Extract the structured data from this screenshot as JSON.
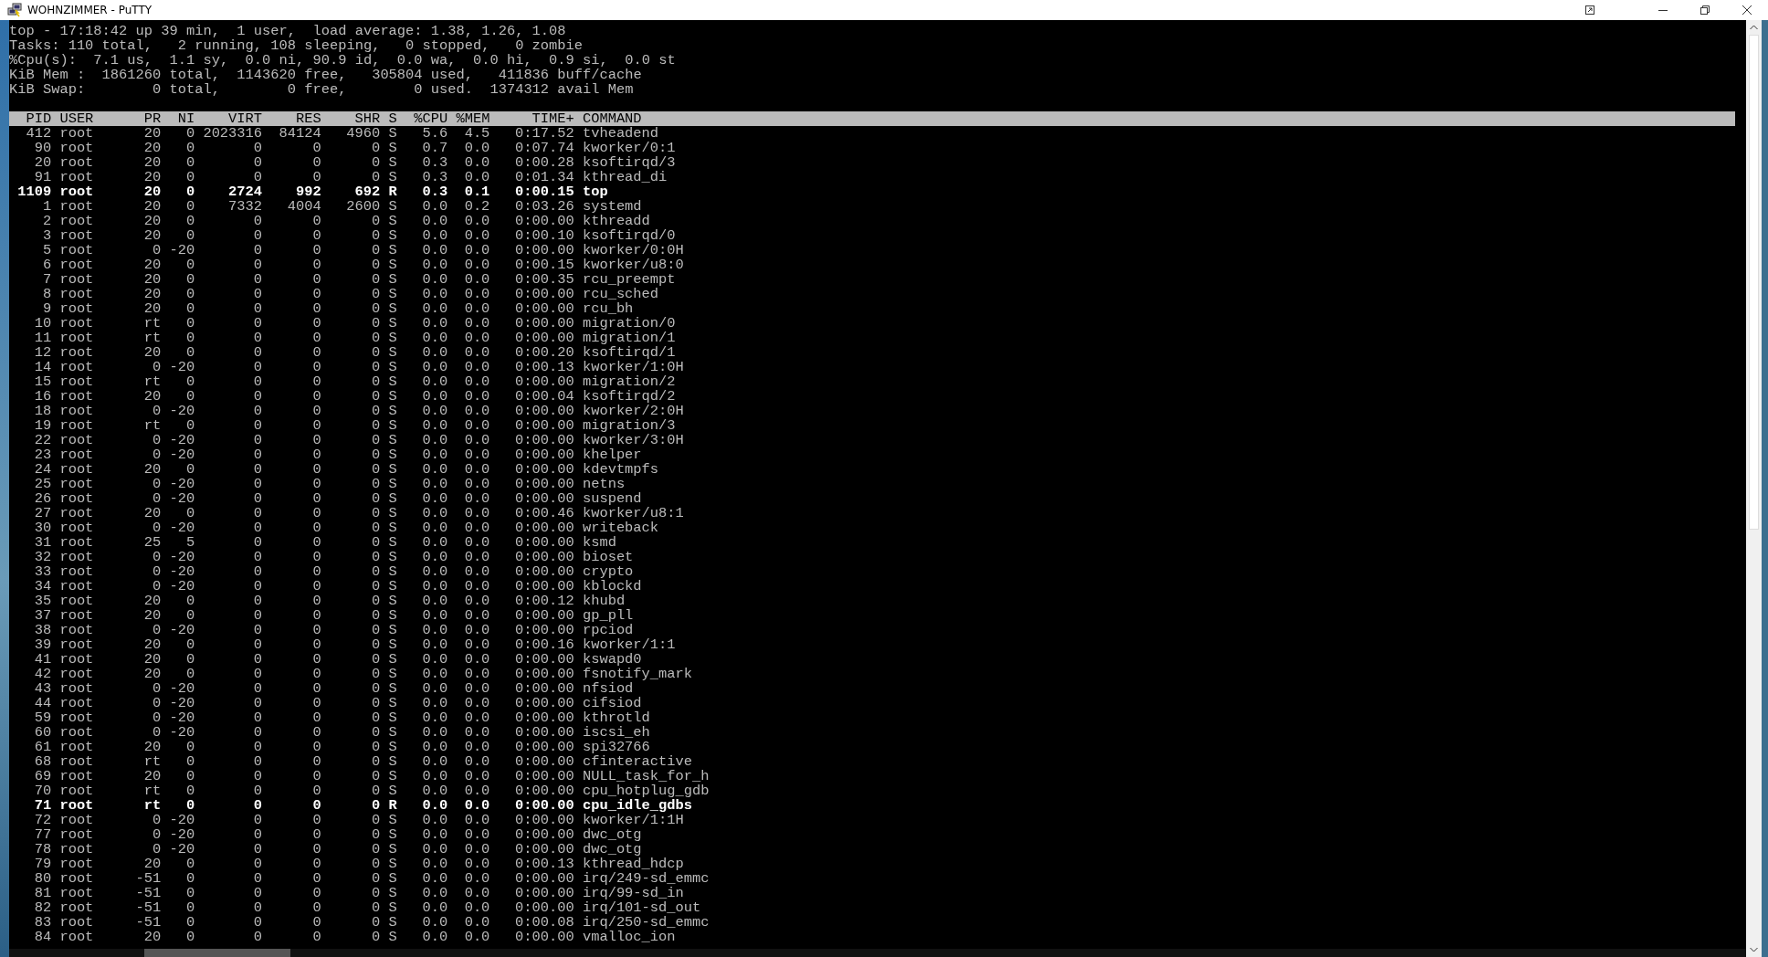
{
  "window": {
    "title": "WOHNZIMMER - PuTTY"
  },
  "summary": [
    "top - 17:18:42 up 39 min,  1 user,  load average: 1.38, 1.26, 1.08",
    "Tasks: 110 total,   2 running, 108 sleeping,   0 stopped,   0 zombie",
    "%Cpu(s):  7.1 us,  1.1 sy,  0.0 ni, 90.9 id,  0.0 wa,  0.0 hi,  0.9 si,  0.0 st",
    "KiB Mem :  1861260 total,  1143620 free,   305804 used,   411836 buff/cache",
    "KiB Swap:        0 total,        0 free,        0 used.  1374312 avail Mem"
  ],
  "columns": [
    "PID",
    "USER",
    "PR",
    "NI",
    "VIRT",
    "RES",
    "SHR",
    "S",
    "%CPU",
    "%MEM",
    "TIME+",
    "COMMAND"
  ],
  "rows": [
    {
      "cells": [
        "412",
        "root",
        "20",
        "0",
        "2023316",
        "84124",
        "4960",
        "S",
        "5.6",
        "4.5",
        "0:17.52",
        "tvheadend"
      ],
      "highlighted": false
    },
    {
      "cells": [
        "90",
        "root",
        "20",
        "0",
        "0",
        "0",
        "0",
        "S",
        "0.7",
        "0.0",
        "0:07.74",
        "kworker/0:1"
      ],
      "highlighted": false
    },
    {
      "cells": [
        "20",
        "root",
        "20",
        "0",
        "0",
        "0",
        "0",
        "S",
        "0.3",
        "0.0",
        "0:00.28",
        "ksoftirqd/3"
      ],
      "highlighted": false
    },
    {
      "cells": [
        "91",
        "root",
        "20",
        "0",
        "0",
        "0",
        "0",
        "S",
        "0.3",
        "0.0",
        "0:01.34",
        "kthread_di"
      ],
      "highlighted": false
    },
    {
      "cells": [
        "1109",
        "root",
        "20",
        "0",
        "2724",
        "992",
        "692",
        "R",
        "0.3",
        "0.1",
        "0:00.15",
        "top"
      ],
      "highlighted": true
    },
    {
      "cells": [
        "1",
        "root",
        "20",
        "0",
        "7332",
        "4004",
        "2600",
        "S",
        "0.0",
        "0.2",
        "0:03.26",
        "systemd"
      ],
      "highlighted": false
    },
    {
      "cells": [
        "2",
        "root",
        "20",
        "0",
        "0",
        "0",
        "0",
        "S",
        "0.0",
        "0.0",
        "0:00.00",
        "kthreadd"
      ],
      "highlighted": false
    },
    {
      "cells": [
        "3",
        "root",
        "20",
        "0",
        "0",
        "0",
        "0",
        "S",
        "0.0",
        "0.0",
        "0:00.10",
        "ksoftirqd/0"
      ],
      "highlighted": false
    },
    {
      "cells": [
        "5",
        "root",
        "0",
        "-20",
        "0",
        "0",
        "0",
        "S",
        "0.0",
        "0.0",
        "0:00.00",
        "kworker/0:0H"
      ],
      "highlighted": false
    },
    {
      "cells": [
        "6",
        "root",
        "20",
        "0",
        "0",
        "0",
        "0",
        "S",
        "0.0",
        "0.0",
        "0:00.15",
        "kworker/u8:0"
      ],
      "highlighted": false
    },
    {
      "cells": [
        "7",
        "root",
        "20",
        "0",
        "0",
        "0",
        "0",
        "S",
        "0.0",
        "0.0",
        "0:00.35",
        "rcu_preempt"
      ],
      "highlighted": false
    },
    {
      "cells": [
        "8",
        "root",
        "20",
        "0",
        "0",
        "0",
        "0",
        "S",
        "0.0",
        "0.0",
        "0:00.00",
        "rcu_sched"
      ],
      "highlighted": false
    },
    {
      "cells": [
        "9",
        "root",
        "20",
        "0",
        "0",
        "0",
        "0",
        "S",
        "0.0",
        "0.0",
        "0:00.00",
        "rcu_bh"
      ],
      "highlighted": false
    },
    {
      "cells": [
        "10",
        "root",
        "rt",
        "0",
        "0",
        "0",
        "0",
        "S",
        "0.0",
        "0.0",
        "0:00.00",
        "migration/0"
      ],
      "highlighted": false
    },
    {
      "cells": [
        "11",
        "root",
        "rt",
        "0",
        "0",
        "0",
        "0",
        "S",
        "0.0",
        "0.0",
        "0:00.00",
        "migration/1"
      ],
      "highlighted": false
    },
    {
      "cells": [
        "12",
        "root",
        "20",
        "0",
        "0",
        "0",
        "0",
        "S",
        "0.0",
        "0.0",
        "0:00.20",
        "ksoftirqd/1"
      ],
      "highlighted": false
    },
    {
      "cells": [
        "14",
        "root",
        "0",
        "-20",
        "0",
        "0",
        "0",
        "S",
        "0.0",
        "0.0",
        "0:00.13",
        "kworker/1:0H"
      ],
      "highlighted": false
    },
    {
      "cells": [
        "15",
        "root",
        "rt",
        "0",
        "0",
        "0",
        "0",
        "S",
        "0.0",
        "0.0",
        "0:00.00",
        "migration/2"
      ],
      "highlighted": false
    },
    {
      "cells": [
        "16",
        "root",
        "20",
        "0",
        "0",
        "0",
        "0",
        "S",
        "0.0",
        "0.0",
        "0:00.04",
        "ksoftirqd/2"
      ],
      "highlighted": false
    },
    {
      "cells": [
        "18",
        "root",
        "0",
        "-20",
        "0",
        "0",
        "0",
        "S",
        "0.0",
        "0.0",
        "0:00.00",
        "kworker/2:0H"
      ],
      "highlighted": false
    },
    {
      "cells": [
        "19",
        "root",
        "rt",
        "0",
        "0",
        "0",
        "0",
        "S",
        "0.0",
        "0.0",
        "0:00.00",
        "migration/3"
      ],
      "highlighted": false
    },
    {
      "cells": [
        "22",
        "root",
        "0",
        "-20",
        "0",
        "0",
        "0",
        "S",
        "0.0",
        "0.0",
        "0:00.00",
        "kworker/3:0H"
      ],
      "highlighted": false
    },
    {
      "cells": [
        "23",
        "root",
        "0",
        "-20",
        "0",
        "0",
        "0",
        "S",
        "0.0",
        "0.0",
        "0:00.00",
        "khelper"
      ],
      "highlighted": false
    },
    {
      "cells": [
        "24",
        "root",
        "20",
        "0",
        "0",
        "0",
        "0",
        "S",
        "0.0",
        "0.0",
        "0:00.00",
        "kdevtmpfs"
      ],
      "highlighted": false
    },
    {
      "cells": [
        "25",
        "root",
        "0",
        "-20",
        "0",
        "0",
        "0",
        "S",
        "0.0",
        "0.0",
        "0:00.00",
        "netns"
      ],
      "highlighted": false
    },
    {
      "cells": [
        "26",
        "root",
        "0",
        "-20",
        "0",
        "0",
        "0",
        "S",
        "0.0",
        "0.0",
        "0:00.00",
        "suspend"
      ],
      "highlighted": false
    },
    {
      "cells": [
        "27",
        "root",
        "20",
        "0",
        "0",
        "0",
        "0",
        "S",
        "0.0",
        "0.0",
        "0:00.46",
        "kworker/u8:1"
      ],
      "highlighted": false
    },
    {
      "cells": [
        "30",
        "root",
        "0",
        "-20",
        "0",
        "0",
        "0",
        "S",
        "0.0",
        "0.0",
        "0:00.00",
        "writeback"
      ],
      "highlighted": false
    },
    {
      "cells": [
        "31",
        "root",
        "25",
        "5",
        "0",
        "0",
        "0",
        "S",
        "0.0",
        "0.0",
        "0:00.00",
        "ksmd"
      ],
      "highlighted": false
    },
    {
      "cells": [
        "32",
        "root",
        "0",
        "-20",
        "0",
        "0",
        "0",
        "S",
        "0.0",
        "0.0",
        "0:00.00",
        "bioset"
      ],
      "highlighted": false
    },
    {
      "cells": [
        "33",
        "root",
        "0",
        "-20",
        "0",
        "0",
        "0",
        "S",
        "0.0",
        "0.0",
        "0:00.00",
        "crypto"
      ],
      "highlighted": false
    },
    {
      "cells": [
        "34",
        "root",
        "0",
        "-20",
        "0",
        "0",
        "0",
        "S",
        "0.0",
        "0.0",
        "0:00.00",
        "kblockd"
      ],
      "highlighted": false
    },
    {
      "cells": [
        "35",
        "root",
        "20",
        "0",
        "0",
        "0",
        "0",
        "S",
        "0.0",
        "0.0",
        "0:00.12",
        "khubd"
      ],
      "highlighted": false
    },
    {
      "cells": [
        "37",
        "root",
        "20",
        "0",
        "0",
        "0",
        "0",
        "S",
        "0.0",
        "0.0",
        "0:00.00",
        "gp_pll"
      ],
      "highlighted": false
    },
    {
      "cells": [
        "38",
        "root",
        "0",
        "-20",
        "0",
        "0",
        "0",
        "S",
        "0.0",
        "0.0",
        "0:00.00",
        "rpciod"
      ],
      "highlighted": false
    },
    {
      "cells": [
        "39",
        "root",
        "20",
        "0",
        "0",
        "0",
        "0",
        "S",
        "0.0",
        "0.0",
        "0:00.16",
        "kworker/1:1"
      ],
      "highlighted": false
    },
    {
      "cells": [
        "41",
        "root",
        "20",
        "0",
        "0",
        "0",
        "0",
        "S",
        "0.0",
        "0.0",
        "0:00.00",
        "kswapd0"
      ],
      "highlighted": false
    },
    {
      "cells": [
        "42",
        "root",
        "20",
        "0",
        "0",
        "0",
        "0",
        "S",
        "0.0",
        "0.0",
        "0:00.00",
        "fsnotify_mark"
      ],
      "highlighted": false
    },
    {
      "cells": [
        "43",
        "root",
        "0",
        "-20",
        "0",
        "0",
        "0",
        "S",
        "0.0",
        "0.0",
        "0:00.00",
        "nfsiod"
      ],
      "highlighted": false
    },
    {
      "cells": [
        "44",
        "root",
        "0",
        "-20",
        "0",
        "0",
        "0",
        "S",
        "0.0",
        "0.0",
        "0:00.00",
        "cifsiod"
      ],
      "highlighted": false
    },
    {
      "cells": [
        "59",
        "root",
        "0",
        "-20",
        "0",
        "0",
        "0",
        "S",
        "0.0",
        "0.0",
        "0:00.00",
        "kthrotld"
      ],
      "highlighted": false
    },
    {
      "cells": [
        "60",
        "root",
        "0",
        "-20",
        "0",
        "0",
        "0",
        "S",
        "0.0",
        "0.0",
        "0:00.00",
        "iscsi_eh"
      ],
      "highlighted": false
    },
    {
      "cells": [
        "61",
        "root",
        "20",
        "0",
        "0",
        "0",
        "0",
        "S",
        "0.0",
        "0.0",
        "0:00.00",
        "spi32766"
      ],
      "highlighted": false
    },
    {
      "cells": [
        "68",
        "root",
        "rt",
        "0",
        "0",
        "0",
        "0",
        "S",
        "0.0",
        "0.0",
        "0:00.00",
        "cfinteractive"
      ],
      "highlighted": false
    },
    {
      "cells": [
        "69",
        "root",
        "20",
        "0",
        "0",
        "0",
        "0",
        "S",
        "0.0",
        "0.0",
        "0:00.00",
        "NULL_task_for_h"
      ],
      "highlighted": false
    },
    {
      "cells": [
        "70",
        "root",
        "rt",
        "0",
        "0",
        "0",
        "0",
        "S",
        "0.0",
        "0.0",
        "0:00.00",
        "cpu_hotplug_gdb"
      ],
      "highlighted": false
    },
    {
      "cells": [
        "71",
        "root",
        "rt",
        "0",
        "0",
        "0",
        "0",
        "R",
        "0.0",
        "0.0",
        "0:00.00",
        "cpu_idle_gdbs"
      ],
      "highlighted": true
    },
    {
      "cells": [
        "72",
        "root",
        "0",
        "-20",
        "0",
        "0",
        "0",
        "S",
        "0.0",
        "0.0",
        "0:00.00",
        "kworker/1:1H"
      ],
      "highlighted": false
    },
    {
      "cells": [
        "77",
        "root",
        "0",
        "-20",
        "0",
        "0",
        "0",
        "S",
        "0.0",
        "0.0",
        "0:00.00",
        "dwc_otg"
      ],
      "highlighted": false
    },
    {
      "cells": [
        "78",
        "root",
        "0",
        "-20",
        "0",
        "0",
        "0",
        "S",
        "0.0",
        "0.0",
        "0:00.00",
        "dwc_otg"
      ],
      "highlighted": false
    },
    {
      "cells": [
        "79",
        "root",
        "20",
        "0",
        "0",
        "0",
        "0",
        "S",
        "0.0",
        "0.0",
        "0:00.13",
        "kthread_hdcp"
      ],
      "highlighted": false
    },
    {
      "cells": [
        "80",
        "root",
        "-51",
        "0",
        "0",
        "0",
        "0",
        "S",
        "0.0",
        "0.0",
        "0:00.00",
        "irq/249-sd_emmc"
      ],
      "highlighted": false
    },
    {
      "cells": [
        "81",
        "root",
        "-51",
        "0",
        "0",
        "0",
        "0",
        "S",
        "0.0",
        "0.0",
        "0:00.00",
        "irq/99-sd_in"
      ],
      "highlighted": false
    },
    {
      "cells": [
        "82",
        "root",
        "-51",
        "0",
        "0",
        "0",
        "0",
        "S",
        "0.0",
        "0.0",
        "0:00.00",
        "irq/101-sd_out"
      ],
      "highlighted": false
    },
    {
      "cells": [
        "83",
        "root",
        "-51",
        "0",
        "0",
        "0",
        "0",
        "S",
        "0.0",
        "0.0",
        "0:00.08",
        "irq/250-sd_emmc"
      ],
      "highlighted": false
    },
    {
      "cells": [
        "84",
        "root",
        "20",
        "0",
        "0",
        "0",
        "0",
        "S",
        "0.0",
        "0.0",
        "0:00.00",
        "vmalloc_ion"
      ],
      "highlighted": false
    }
  ]
}
